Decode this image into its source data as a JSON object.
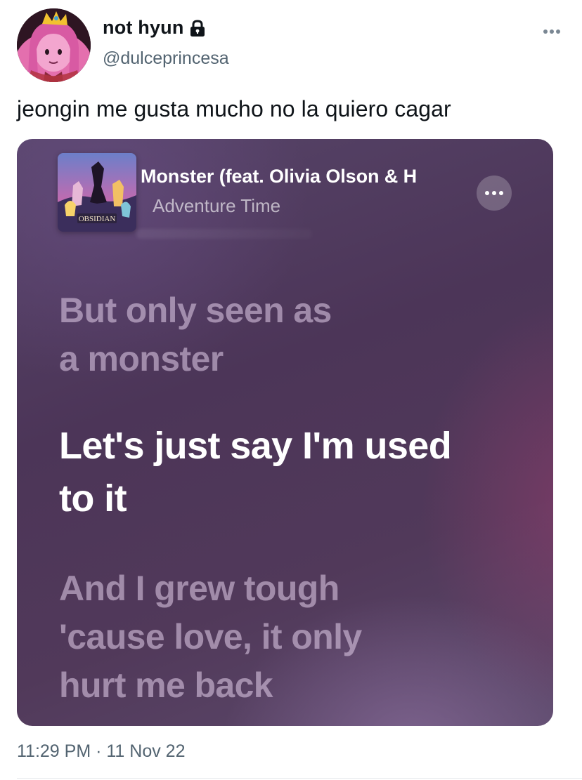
{
  "tweet": {
    "author": {
      "display_name": "not hyun",
      "handle": "@dulceprincesa",
      "protected_icon": "lock-icon",
      "avatar_icon": "princess-bubblegum-avatar"
    },
    "more_icon": "more-horizontal-icon",
    "text": "jeongin me gusta mucho no la quiero cagar",
    "timestamp": "11:29 PM · 11 Nov 22"
  },
  "media": {
    "song_title": "Monster (feat. Olivia Olson & H",
    "artist": "Adventure Time",
    "album_art_icon": "album-art-obsidian",
    "album_text": "OBSIDIAN",
    "more_icon": "more-circle-icon",
    "lyrics": {
      "line1": [
        "But only seen as",
        "a monster"
      ],
      "line2": [
        "Let's just say I'm used",
        "to it"
      ],
      "line3": [
        "And I grew tough",
        "'cause love, it only",
        "hurt me back"
      ]
    },
    "colors": {
      "background": "#4e3759",
      "active_lyric": "#ffffff",
      "dim_lyric": "#b9a6c2"
    }
  },
  "colors": {
    "text_primary": "#0f1419",
    "text_secondary": "#536471"
  }
}
